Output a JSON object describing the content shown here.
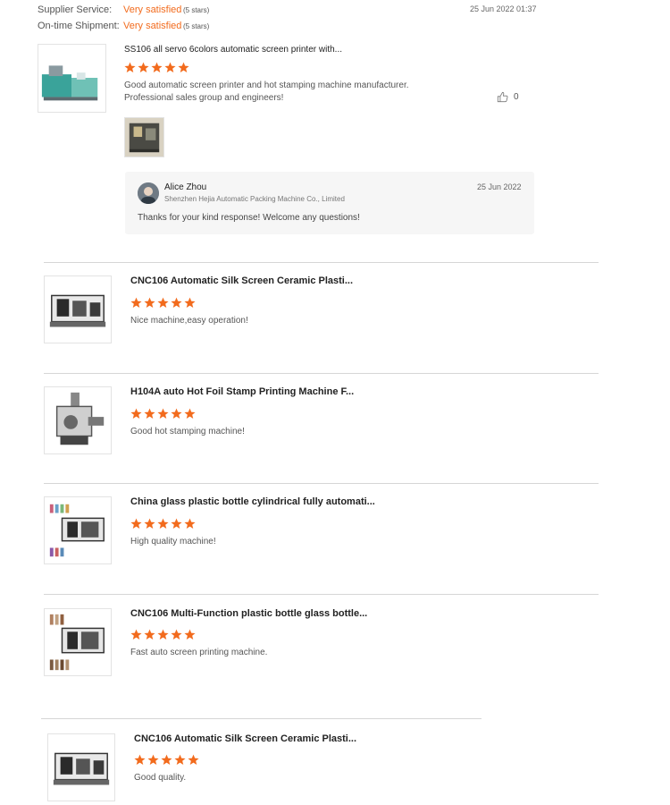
{
  "header": {
    "supplier_service_label": "Supplier Service:",
    "supplier_service_value": "Very satisfied",
    "supplier_service_stars": "(5 stars)",
    "ontime_label": "On-time Shipment:",
    "ontime_value": "Very satisfied",
    "ontime_stars": "(5 stars)",
    "timestamp": "25 Jun 2022 01:37"
  },
  "main_review": {
    "product_title": "SS106 all servo 6colors automatic screen printer with...",
    "rating": 5,
    "comment_line1": "Good automatic screen printer and hot stamping machine manufacturer.",
    "comment_line2": "Professional sales group and engineers!",
    "like_count": "0",
    "reply": {
      "name": "Alice Zhou",
      "company": "Shenzhen Hejia Automatic Packing Machine Co., Limited",
      "date": "25 Jun 2022",
      "text": "Thanks for your kind response! Welcome any questions!"
    }
  },
  "reviews": [
    {
      "title": "CNC106 Automatic Silk Screen Ceramic Plasti...",
      "rating": 5,
      "comment": "Nice machine,easy operation!"
    },
    {
      "title": "H104A auto Hot Foil Stamp Printing Machine F...",
      "rating": 5,
      "comment": "Good hot stamping machine!"
    },
    {
      "title": "China glass plastic bottle cylindrical fully automati...",
      "rating": 5,
      "comment": "High quality machine!"
    },
    {
      "title": "CNC106 Multi-Function plastic bottle glass bottle...",
      "rating": 5,
      "comment": "Fast auto screen printing machine."
    },
    {
      "title": "CNC106 Automatic Silk Screen Ceramic Plasti...",
      "rating": 5,
      "comment": "Good quality."
    }
  ],
  "colors": {
    "accent": "#f26b1d",
    "star": "#f26b1d",
    "divider": "#d6d6d6",
    "reply_bg": "#f6f6f6"
  },
  "icons": {
    "star": "star-icon",
    "like": "thumbs-up-icon"
  }
}
